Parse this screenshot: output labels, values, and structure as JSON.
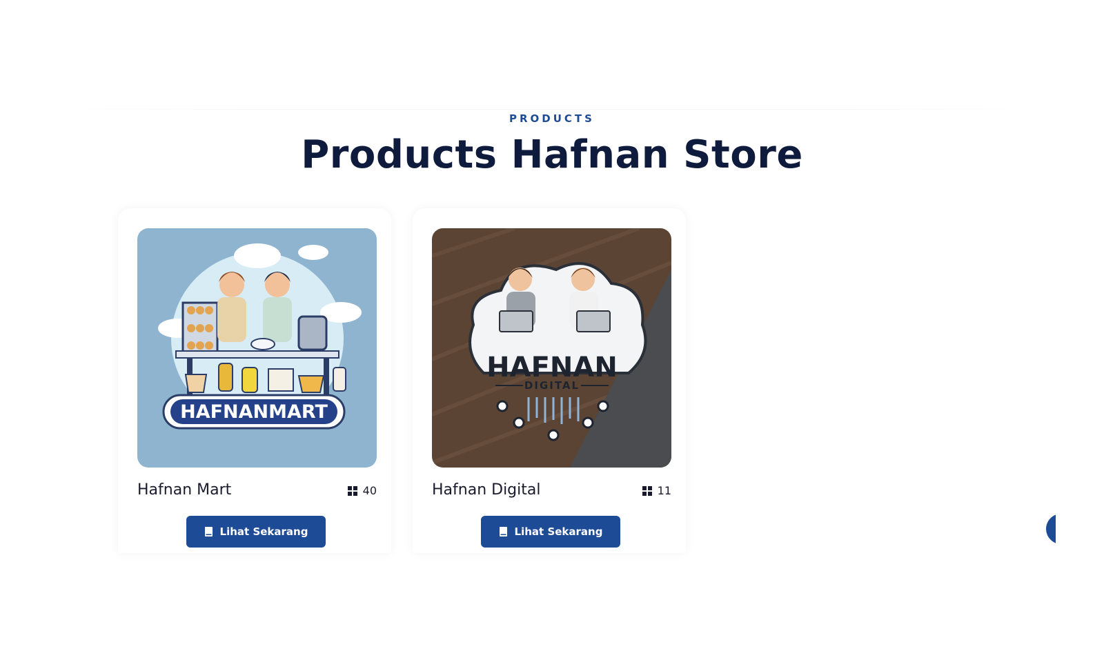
{
  "section": {
    "eyebrow": "PRODUCTS",
    "title": "Products Hafnan Store"
  },
  "products": [
    {
      "name": "Hafnan Mart",
      "count": "40",
      "button_label": "Lihat Sekarang",
      "logo_text": "HAFNANMART",
      "icon": "grid-icon",
      "button_icon": "book-icon"
    },
    {
      "name": "Hafnan Digital",
      "count": "11",
      "button_label": "Lihat Sekarang",
      "logo_text": "HAFNAN",
      "logo_subtext": "DIGITAL",
      "icon": "grid-icon",
      "button_icon": "book-icon"
    }
  ],
  "colors": {
    "accent": "#1e4b96",
    "title": "#0f1b3d"
  }
}
